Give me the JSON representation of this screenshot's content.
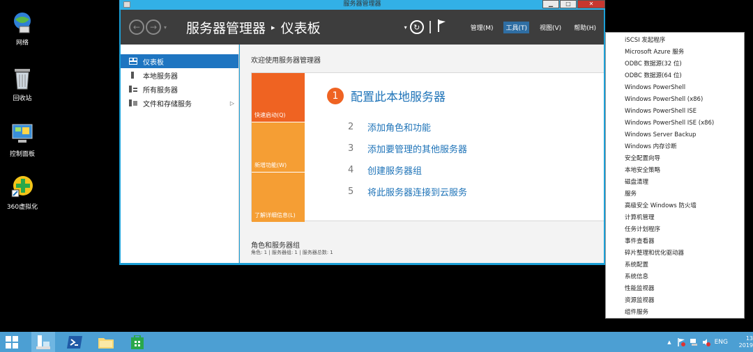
{
  "desktop": {
    "icons": [
      {
        "label": "网络"
      },
      {
        "label": "回收站"
      },
      {
        "label": "控制面板"
      },
      {
        "label": "360虚拟化"
      }
    ]
  },
  "window": {
    "title": "服务器管理器",
    "close_glyph": "✕",
    "minimize_glyph": "▁",
    "maximize_glyph": "□"
  },
  "ribbon": {
    "back_glyph": "←",
    "forward_glyph": "→",
    "dropdown_glyph": "▾",
    "breadcrumb_root": "服务器管理器",
    "breadcrumb_sep": "▸",
    "breadcrumb_page": "仪表板",
    "refresh_glyph": "↻",
    "menus": {
      "manage": "管理(M)",
      "tools": "工具(T)",
      "view": "视图(V)",
      "help": "帮助(H)"
    }
  },
  "sidebar": {
    "items": [
      {
        "label": "仪表板"
      },
      {
        "label": "本地服务器"
      },
      {
        "label": "所有服务器"
      },
      {
        "label": "文件和存储服务"
      }
    ],
    "arrow_glyph": "▷"
  },
  "main": {
    "welcome_title": "欢迎使用服务器管理器",
    "tiles": {
      "quick_start": "快速启动(Q)",
      "whats_new": "新增功能(W)",
      "learn_more": "了解详细信息(L)"
    },
    "steps": [
      {
        "num": "1",
        "label": "配置此本地服务器"
      },
      {
        "num": "2",
        "label": "添加角色和功能"
      },
      {
        "num": "3",
        "label": "添加要管理的其他服务器"
      },
      {
        "num": "4",
        "label": "创建服务器组"
      },
      {
        "num": "5",
        "label": "将此服务器连接到云服务"
      }
    ],
    "roles_title": "角色和服务器组",
    "roles_sub": "角色: 1 | 服务器组: 1 | 服务器总数: 1"
  },
  "tools_menu": {
    "items": [
      "iSCSI 发起程序",
      "Microsoft Azure 服务",
      "ODBC 数据源(32 位)",
      "ODBC 数据源(64 位)",
      "Windows PowerShell",
      "Windows PowerShell (x86)",
      "Windows PowerShell ISE",
      "Windows PowerShell ISE (x86)",
      "Windows Server Backup",
      "Windows 内存诊断",
      "安全配置向导",
      "本地安全策略",
      "磁盘清理",
      "服务",
      "高级安全 Windows 防火墙",
      "计算机管理",
      "任务计划程序",
      "事件查看器",
      "碎片整理和优化驱动器",
      "系统配置",
      "系统信息",
      "性能监视器",
      "资源监视器",
      "组件服务"
    ]
  },
  "taskbar": {
    "tray_up": "▲",
    "language": "ENG",
    "time": "13",
    "date": "2019"
  }
}
